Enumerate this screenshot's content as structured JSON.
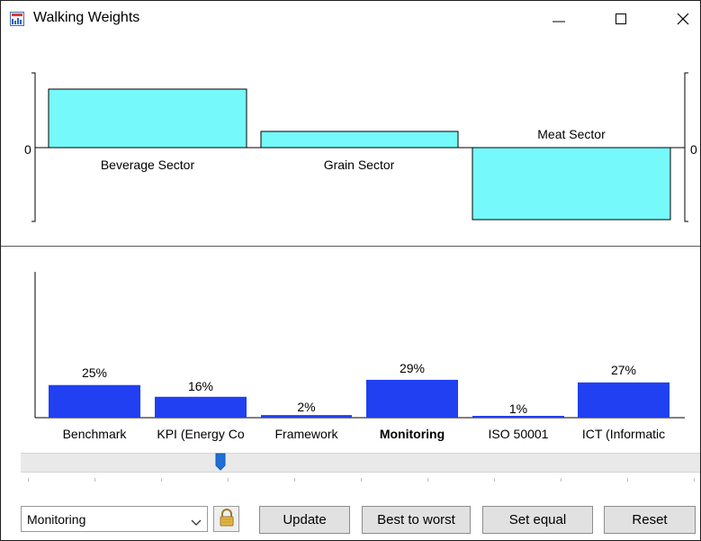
{
  "window": {
    "title": "Walking Weights"
  },
  "top_chart": {
    "zero_label_left": "0",
    "zero_label_right": "0",
    "categories": [
      "Beverage Sector",
      "Grain Sector",
      "Meat Sector"
    ],
    "bar_color": "#76f9fb"
  },
  "bottom_chart": {
    "bar_color": "#2040f2",
    "categories": [
      "Benchmark",
      "KPI (Energy Co",
      "Framework",
      "Monitoring",
      "ISO 50001",
      "ICT (Informatic"
    ],
    "percent_labels": [
      "25%",
      "16%",
      "2%",
      "29%",
      "1%",
      "27%"
    ],
    "selected": "Monitoring"
  },
  "chart_data": [
    {
      "type": "bar",
      "title": "",
      "xlabel": "",
      "ylabel": "",
      "categories": [
        "Beverage Sector",
        "Grain Sector",
        "Meat Sector"
      ],
      "values": [
        65,
        18,
        -80
      ],
      "ylim": [
        -82,
        82
      ],
      "grid": false
    },
    {
      "type": "bar",
      "title": "",
      "xlabel": "",
      "ylabel": "",
      "categories": [
        "Benchmark",
        "KPI (Energy Co",
        "Framework",
        "Monitoring",
        "ISO 50001",
        "ICT (Informatic"
      ],
      "values": [
        25,
        16,
        2,
        29,
        1,
        27
      ],
      "ylim": [
        0,
        100
      ],
      "grid": false
    }
  ],
  "slider": {
    "value_fraction": 0.29
  },
  "controls": {
    "criterion_select": "Monitoring",
    "update_label": "Update",
    "best_to_worst_label": "Best to worst",
    "set_equal_label": "Set equal",
    "reset_label": "Reset"
  }
}
